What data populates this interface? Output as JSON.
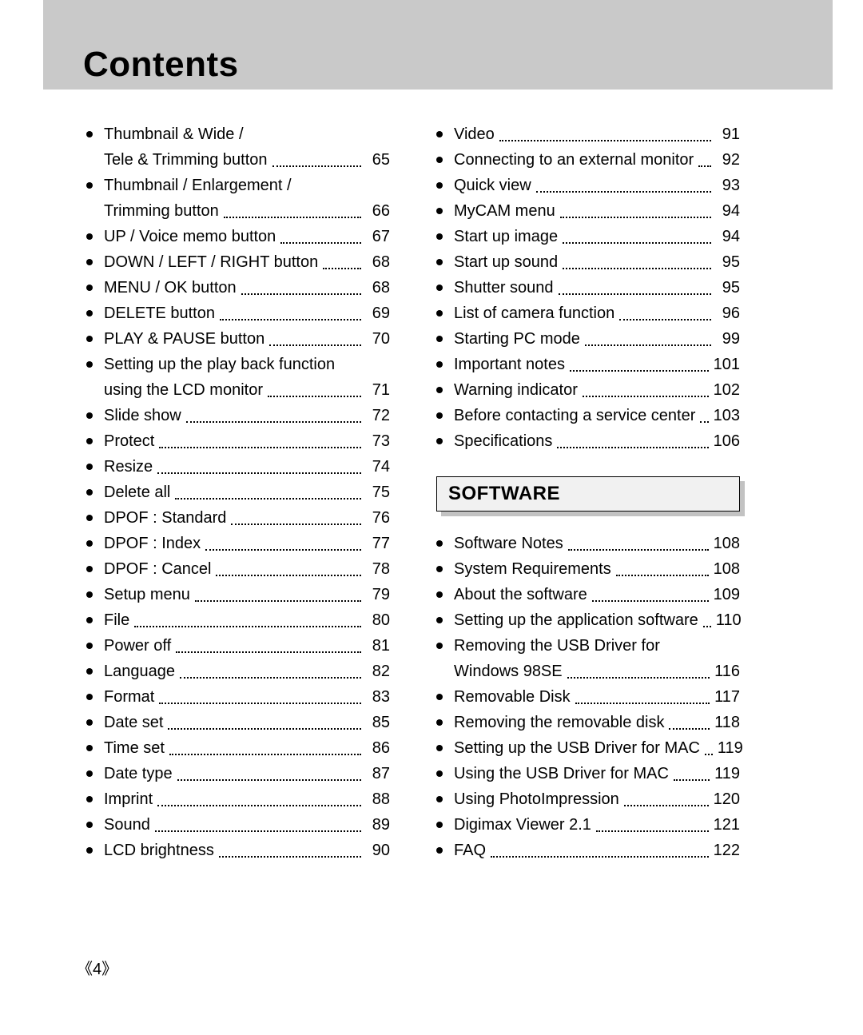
{
  "title": "Contents",
  "page_number_display": "4",
  "section_heading": "SOFTWARE",
  "left_column": [
    {
      "type": "entry-multi",
      "label1": "Thumbnail & Wide /",
      "label2": "Tele & Trimming button",
      "page": "65"
    },
    {
      "type": "entry-multi",
      "label1": "Thumbnail / Enlargement /",
      "label2": "Trimming button",
      "page": "66"
    },
    {
      "type": "entry",
      "label": "UP / Voice memo button",
      "page": "67"
    },
    {
      "type": "entry",
      "label": "DOWN / LEFT / RIGHT button",
      "page": "68"
    },
    {
      "type": "entry",
      "label": "MENU / OK button",
      "page": "68"
    },
    {
      "type": "entry",
      "label": "DELETE button",
      "page": "69"
    },
    {
      "type": "entry",
      "label": "PLAY & PAUSE button",
      "page": "70"
    },
    {
      "type": "entry-multi",
      "label1": "Setting up the play back function",
      "label2": "using the LCD monitor",
      "page": "71"
    },
    {
      "type": "entry",
      "label": "Slide show",
      "page": "72"
    },
    {
      "type": "entry",
      "label": "Protect",
      "page": "73"
    },
    {
      "type": "entry",
      "label": "Resize",
      "page": "74"
    },
    {
      "type": "entry",
      "label": "Delete all",
      "page": "75"
    },
    {
      "type": "entry",
      "label": "DPOF : Standard",
      "page": "76"
    },
    {
      "type": "entry",
      "label": "DPOF : Index",
      "page": "77"
    },
    {
      "type": "entry",
      "label": "DPOF : Cancel",
      "page": "78"
    },
    {
      "type": "entry",
      "label": "Setup menu",
      "page": "79"
    },
    {
      "type": "entry",
      "label": "File",
      "page": "80"
    },
    {
      "type": "entry",
      "label": "Power off",
      "page": "81"
    },
    {
      "type": "entry",
      "label": "Language",
      "page": "82"
    },
    {
      "type": "entry",
      "label": "Format",
      "page": "83"
    },
    {
      "type": "entry",
      "label": "Date set",
      "page": "85"
    },
    {
      "type": "entry",
      "label": "Time set",
      "page": "86"
    },
    {
      "type": "entry",
      "label": "Date type",
      "page": "87"
    },
    {
      "type": "entry",
      "label": "Imprint",
      "page": "88"
    },
    {
      "type": "entry",
      "label": "Sound",
      "page": "89"
    },
    {
      "type": "entry",
      "label": "LCD brightness",
      "page": "90"
    }
  ],
  "right_top": [
    {
      "type": "entry",
      "label": "Video",
      "page": "91"
    },
    {
      "type": "entry",
      "label": "Connecting to an external monitor",
      "page": "92"
    },
    {
      "type": "entry",
      "label": "Quick view",
      "page": "93"
    },
    {
      "type": "entry",
      "label": "MyCAM menu",
      "page": "94"
    },
    {
      "type": "entry",
      "label": "Start up image",
      "page": "94"
    },
    {
      "type": "entry",
      "label": "Start up sound",
      "page": "95"
    },
    {
      "type": "entry",
      "label": "Shutter sound",
      "page": "95"
    },
    {
      "type": "entry",
      "label": "List of camera function",
      "page": "96"
    },
    {
      "type": "entry",
      "label": "Starting PC mode",
      "page": "99"
    },
    {
      "type": "entry",
      "label": "Important notes",
      "page": "101"
    },
    {
      "type": "entry",
      "label": "Warning indicator",
      "page": "102"
    },
    {
      "type": "entry",
      "label": "Before contacting a service center",
      "page": "103"
    },
    {
      "type": "entry",
      "label": "Specifications",
      "page": "106"
    }
  ],
  "right_software": [
    {
      "type": "entry",
      "label": "Software Notes",
      "page": "108"
    },
    {
      "type": "entry",
      "label": "System Requirements",
      "page": "108"
    },
    {
      "type": "entry",
      "label": "About the software",
      "page": "109"
    },
    {
      "type": "entry",
      "label": "Setting up the application software",
      "page": "110"
    },
    {
      "type": "entry-multi",
      "label1": "Removing the USB Driver for",
      "label2": "Windows 98SE",
      "page": "116"
    },
    {
      "type": "entry",
      "label": "Removable Disk",
      "page": "117"
    },
    {
      "type": "entry",
      "label": "Removing the removable disk",
      "page": "118"
    },
    {
      "type": "entry",
      "label": "Setting up the USB Driver for MAC",
      "page": "119"
    },
    {
      "type": "entry",
      "label": "Using the USB Driver for MAC",
      "page": "119"
    },
    {
      "type": "entry",
      "label": "Using PhotoImpression",
      "page": "120"
    },
    {
      "type": "entry",
      "label": "Digimax Viewer 2.1",
      "page": "121"
    },
    {
      "type": "entry",
      "label": "FAQ",
      "page": "122"
    }
  ]
}
